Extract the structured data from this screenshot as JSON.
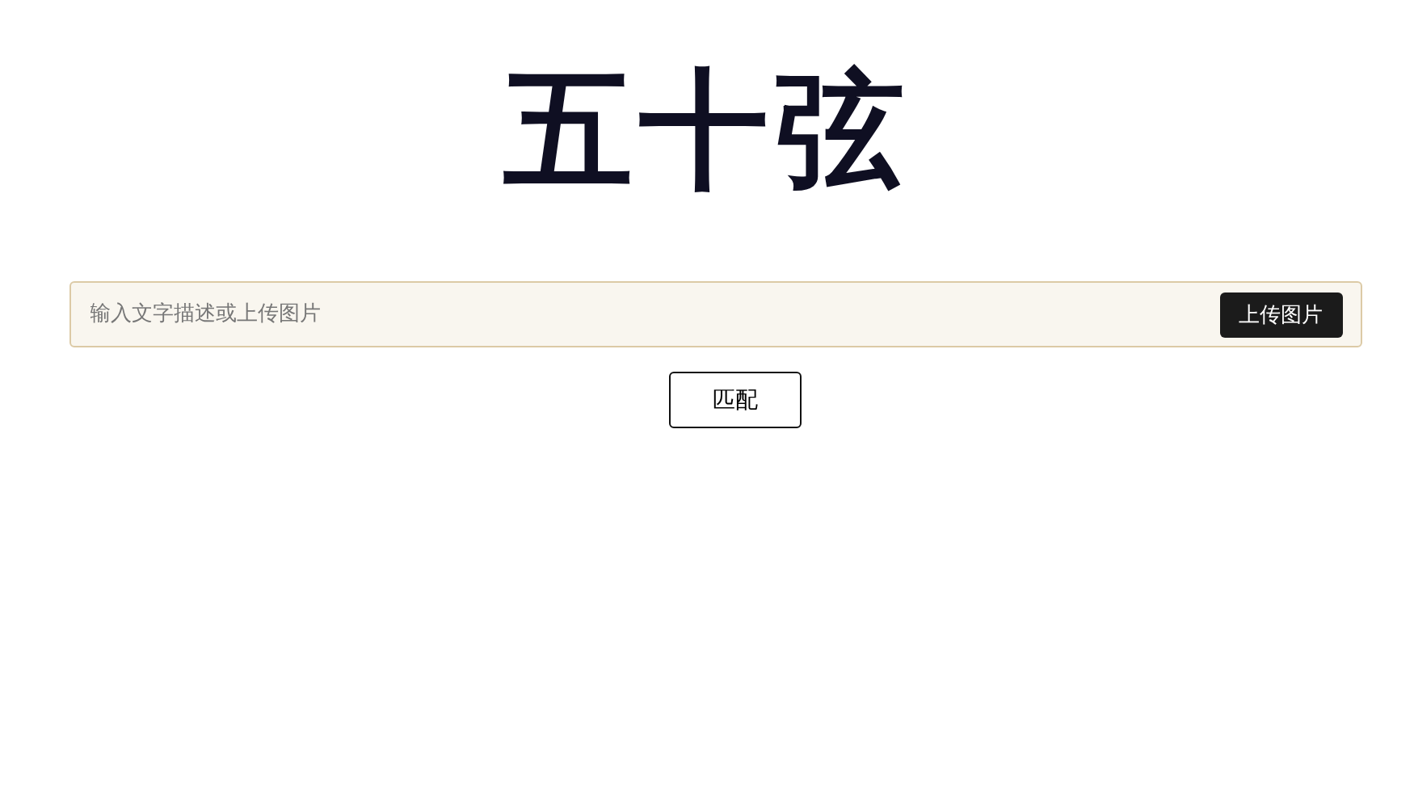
{
  "logo": {
    "text": "五十弦"
  },
  "search": {
    "placeholder": "输入文字描述或上传图片",
    "upload_button": "上传图片"
  },
  "match_button": "匹配"
}
